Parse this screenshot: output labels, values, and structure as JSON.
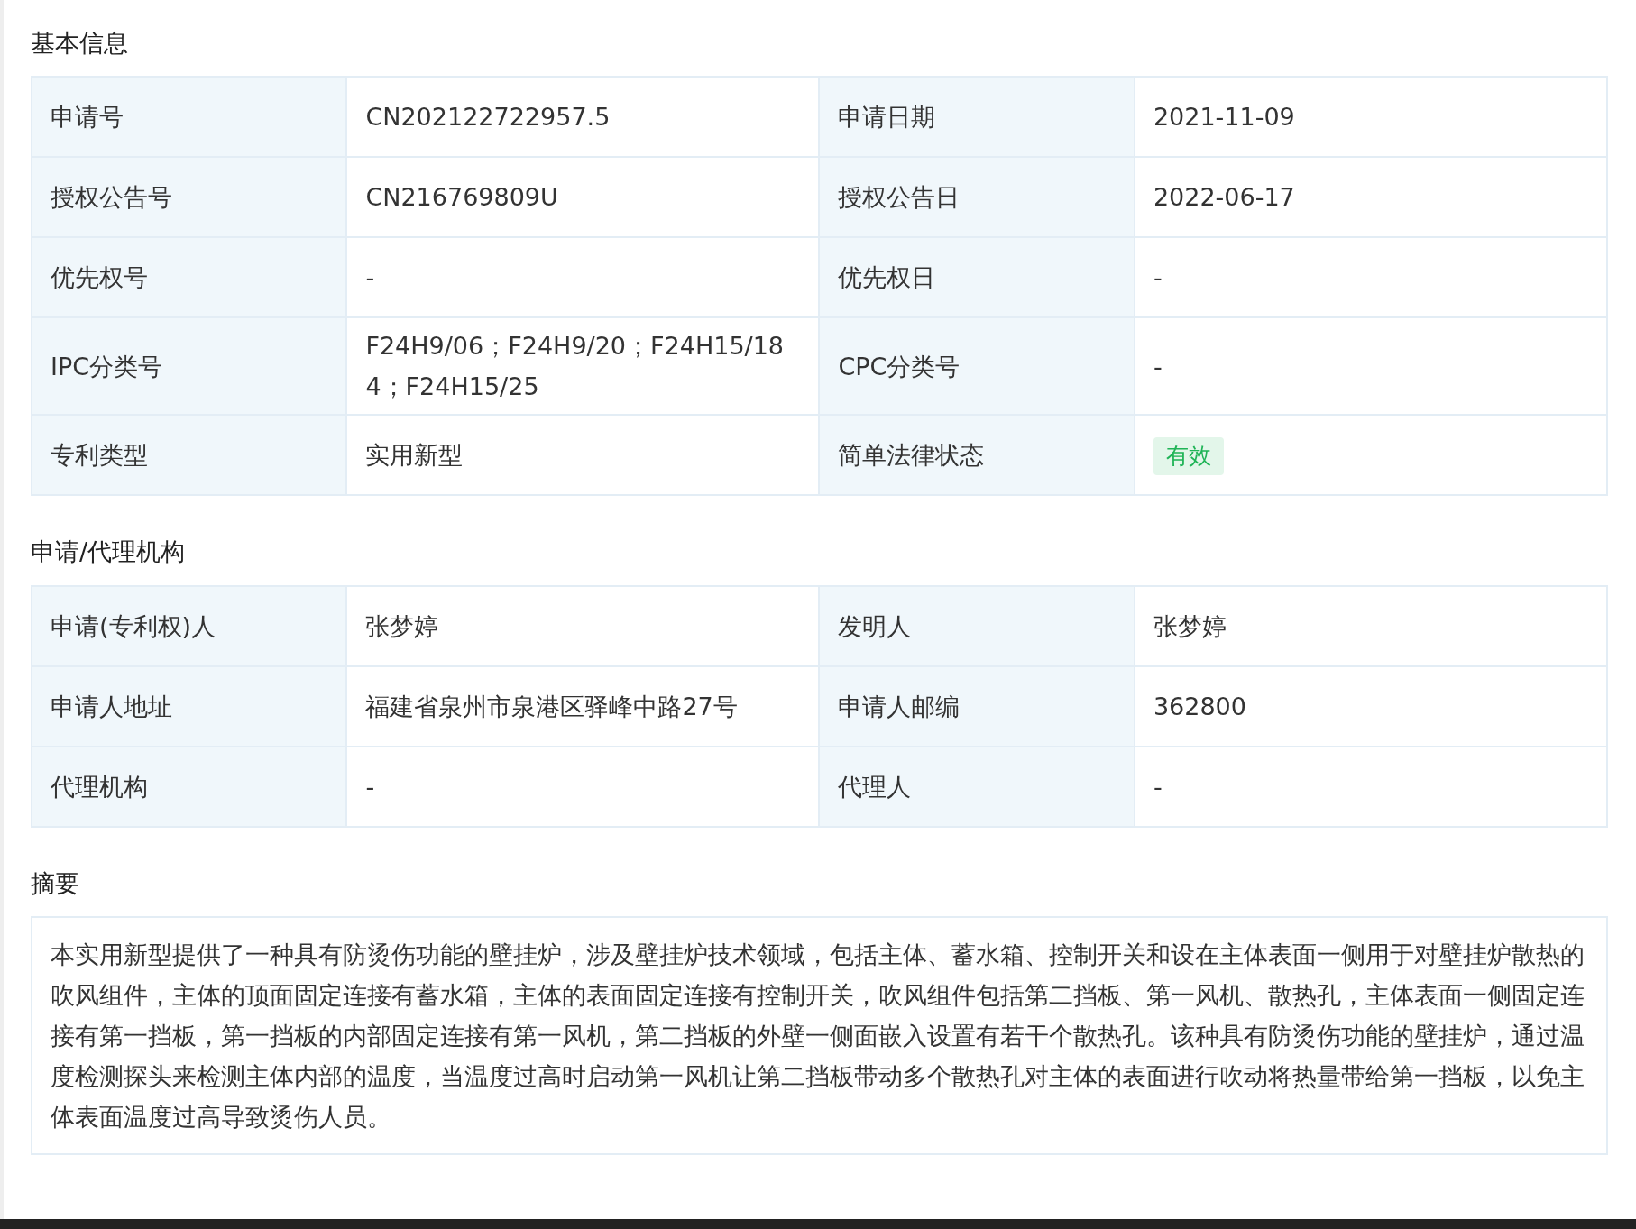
{
  "sections": [
    {
      "title": "基本信息",
      "kind": "table",
      "rows": [
        [
          {
            "label": "申请号",
            "value": "CN202122722957.5"
          },
          {
            "label": "申请日期",
            "value": "2021-11-09"
          }
        ],
        [
          {
            "label": "授权公告号",
            "value": "CN216769809U"
          },
          {
            "label": "授权公告日",
            "value": "2022-06-17"
          }
        ],
        [
          {
            "label": "优先权号",
            "value": "-"
          },
          {
            "label": "优先权日",
            "value": "-"
          }
        ],
        [
          {
            "label": "IPC分类号",
            "value": "F24H9/06；F24H9/20；F24H15/184；F24H15/25"
          },
          {
            "label": "CPC分类号",
            "value": "-"
          }
        ],
        [
          {
            "label": "专利类型",
            "value": "实用新型"
          },
          {
            "label": "简单法律状态",
            "value": "有效",
            "kind": "tag"
          }
        ]
      ]
    },
    {
      "title": "申请/代理机构",
      "kind": "table",
      "rows": [
        [
          {
            "label": "申请(专利权)人",
            "value": "张梦婷"
          },
          {
            "label": "发明人",
            "value": "张梦婷"
          }
        ],
        [
          {
            "label": "申请人地址",
            "value": "福建省泉州市泉港区驿峰中路27号"
          },
          {
            "label": "申请人邮编",
            "value": "362800"
          }
        ],
        [
          {
            "label": "代理机构",
            "value": "-"
          },
          {
            "label": "代理人",
            "value": "-"
          }
        ]
      ]
    },
    {
      "title": "摘要",
      "kind": "text",
      "text": "本实用新型提供了一种具有防烫伤功能的壁挂炉，涉及壁挂炉技术领域，包括主体、蓄水箱、控制开关和设在主体表面一侧用于对壁挂炉散热的吹风组件，主体的顶面固定连接有蓄水箱，主体的表面固定连接有控制开关，吹风组件包括第二挡板、第一风机、散热孔，主体表面一侧固定连接有第一挡板，第一挡板的内部固定连接有第一风机，第二挡板的外壁一侧面嵌入设置有若干个散热孔。该种具有防烫伤功能的壁挂炉，通过温度检测探头来检测主体内部的温度，当温度过高时启动第一风机让第二挡板带动多个散热孔对主体的表面进行吹动将热量带给第一挡板，以免主体表面温度过高导致烫伤人员。"
    }
  ]
}
